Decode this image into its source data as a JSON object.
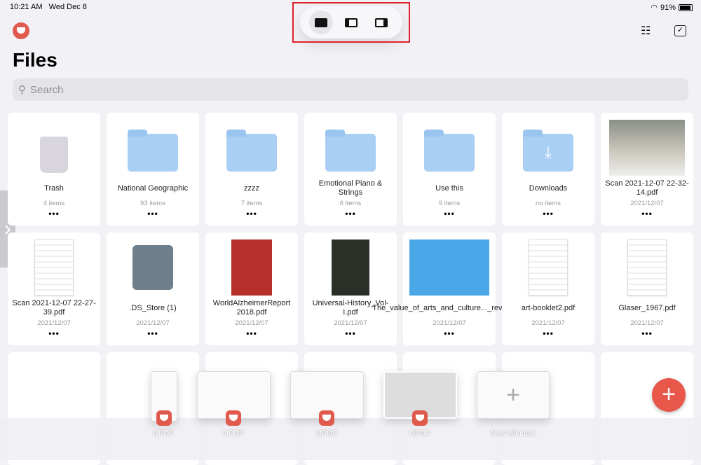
{
  "status": {
    "time": "10:21 AM",
    "date": "Wed Dec 8",
    "battery": "91%",
    "battery_level": 0.91
  },
  "multitask": {
    "options": [
      "full-screen",
      "split-view",
      "slide-over"
    ],
    "selected": "full-screen"
  },
  "header": {
    "title": "Files"
  },
  "search": {
    "placeholder": "Search"
  },
  "accent": "#e9564a",
  "items": [
    {
      "name": "Trash",
      "sub": "4 items",
      "type": "trash"
    },
    {
      "name": "National Geographic",
      "sub": "93 items",
      "type": "folder"
    },
    {
      "name": "zzzz",
      "sub": "7 items",
      "type": "folder"
    },
    {
      "name": "Emotional Piano & Strings",
      "sub": "6 items",
      "type": "folder"
    },
    {
      "name": "Use this",
      "sub": "9 items",
      "type": "folder"
    },
    {
      "name": "Downloads",
      "sub": "no items",
      "type": "downloads"
    },
    {
      "name": "Scan 2021-12-07 22-32-14.pdf",
      "sub": "2021/12/07",
      "type": "photo"
    },
    {
      "name": "Scan 2021-12-07 22-27-39.pdf",
      "sub": "2021/12/07",
      "type": "doc"
    },
    {
      "name": ".DS_Store (1)",
      "sub": "2021/12/07",
      "type": "file"
    },
    {
      "name": "WorldAlzheimerReport 2018.pdf",
      "sub": "2021/12/07",
      "type": "red"
    },
    {
      "name": "Universal-History_Vol-I.pdf",
      "sub": "2021/12/07",
      "type": "book"
    },
    {
      "name": "The_value_of_arts_and_culture..._review.pdf",
      "sub": "2021/12/07",
      "type": "blue"
    },
    {
      "name": "art-booklet2.pdf",
      "sub": "2021/12/07",
      "type": "doc"
    },
    {
      "name": "Glaser_1967.pdf",
      "sub": "2021/12/07",
      "type": "doc"
    }
  ],
  "windows": [
    {
      "label": "UPDF"
    },
    {
      "label": "UPDF"
    },
    {
      "label": "UPDF"
    },
    {
      "label": "UPDF"
    },
    {
      "label": "New Window"
    }
  ]
}
